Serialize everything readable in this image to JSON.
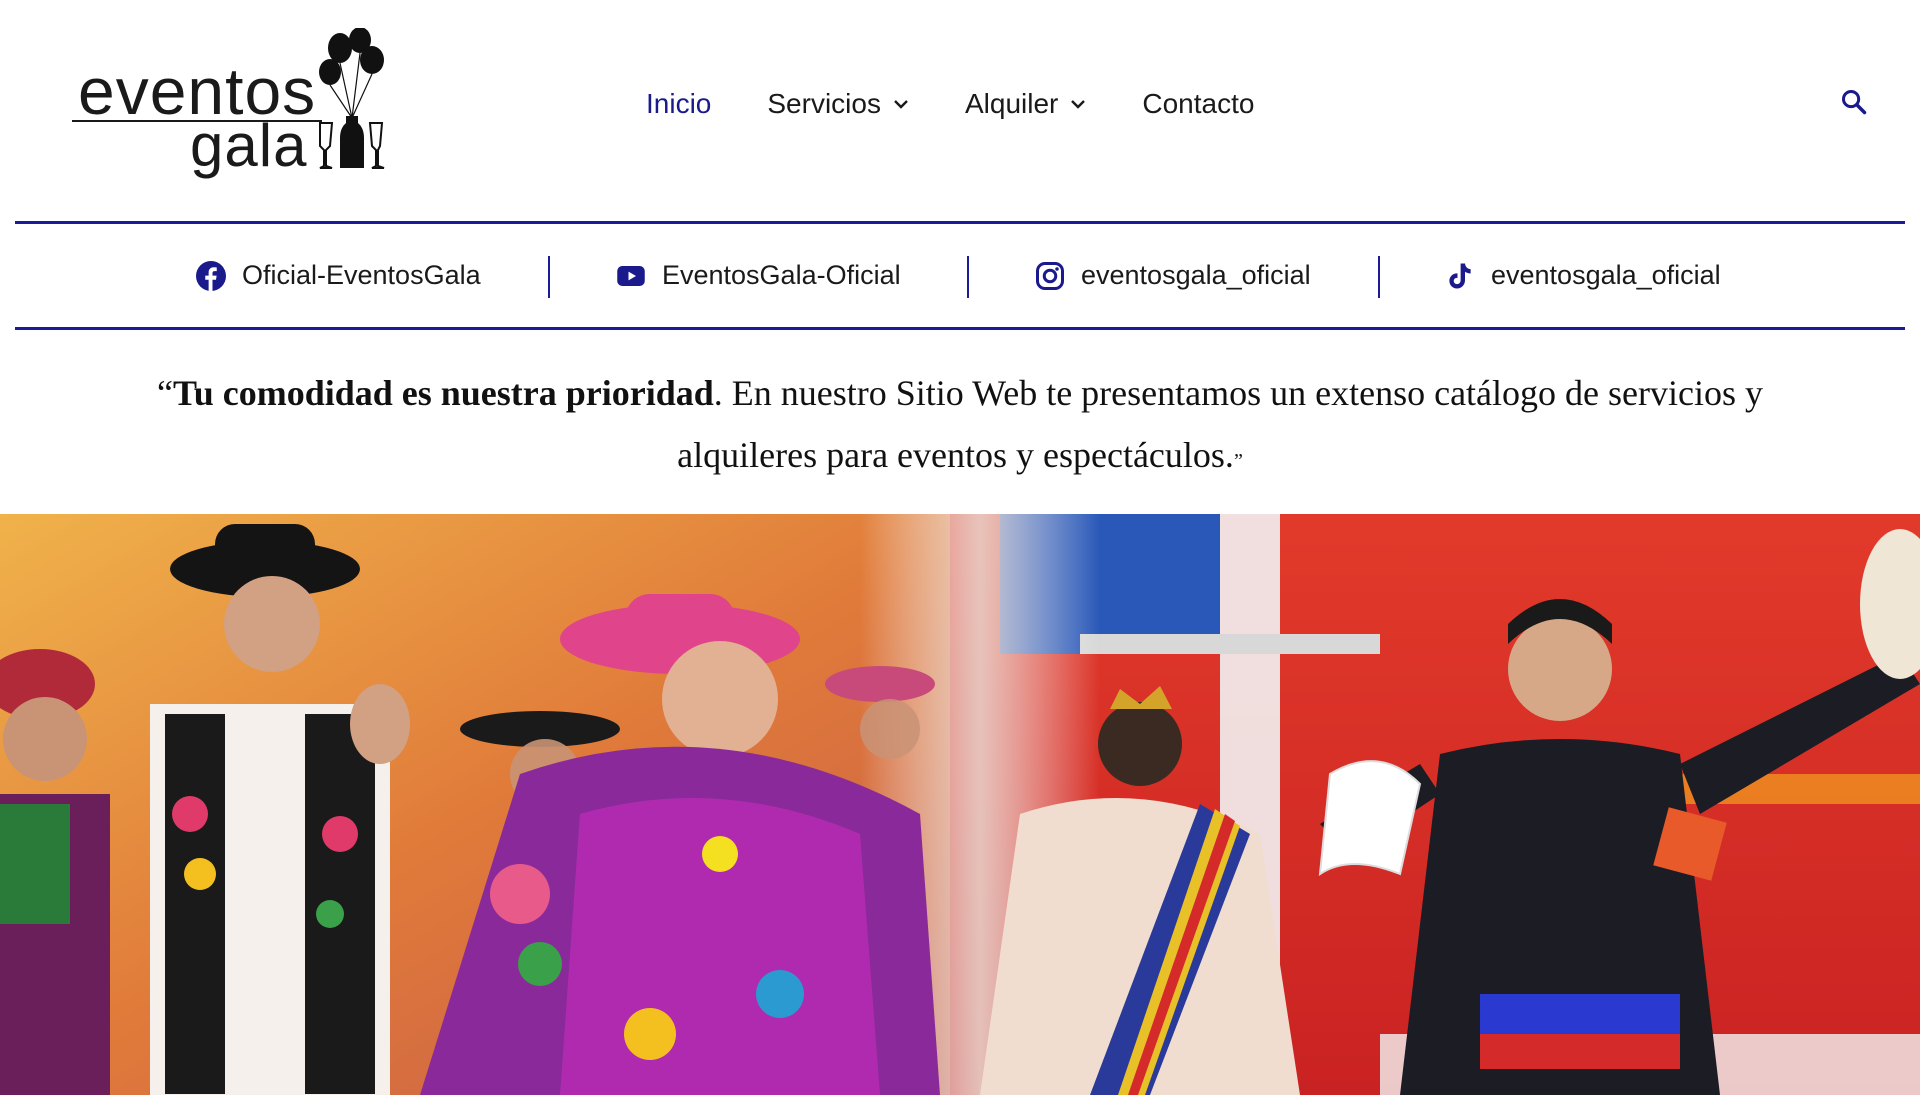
{
  "logo": {
    "line1": "eventos",
    "line2": "gala"
  },
  "nav": {
    "items": [
      {
        "label": "Inicio",
        "active": true,
        "dropdown": false
      },
      {
        "label": "Servicios",
        "active": false,
        "dropdown": true
      },
      {
        "label": "Alquiler",
        "active": false,
        "dropdown": true
      },
      {
        "label": "Contacto",
        "active": false,
        "dropdown": false
      }
    ],
    "search_icon": "search-icon"
  },
  "social": [
    {
      "icon": "facebook-icon",
      "label": "Oficial-EventosGala"
    },
    {
      "icon": "youtube-icon",
      "label": "EventosGala-Oficial"
    },
    {
      "icon": "instagram-icon",
      "label": "eventosgala_oficial"
    },
    {
      "icon": "tiktok-icon",
      "label": "eventosgala_oficial"
    }
  ],
  "tagline": {
    "open_quote": "“",
    "bold": "Tu comodidad es nuestra prioridad",
    "rest": ". En nuestro Sitio Web te presentamos un extenso catálogo de servicios y alquileres para eventos y espectáculos.",
    "close_quote": "”"
  },
  "colors": {
    "accent": "#1a1a9a",
    "nav_active": "#1a1a8c",
    "text": "#1a1a1a"
  }
}
